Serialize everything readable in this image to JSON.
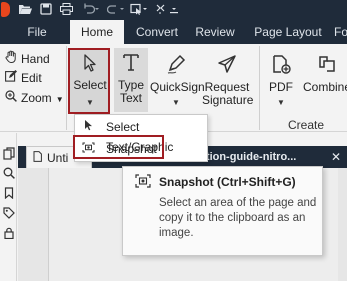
{
  "quick_access": {
    "icons": [
      "nitro-logo",
      "open-folder-icon",
      "save-icon",
      "print-icon",
      "undo-icon",
      "redo-icon",
      "dropdown-tool-icon",
      "customize-icon"
    ]
  },
  "tabs": [
    {
      "label": "File"
    },
    {
      "label": "Home"
    },
    {
      "label": "Convert"
    },
    {
      "label": "Review"
    },
    {
      "label": "Page Layout"
    },
    {
      "label": "Fo"
    }
  ],
  "ribbon": {
    "view_items": [
      {
        "label": "Hand",
        "icon": "hand-icon"
      },
      {
        "label": "Edit",
        "icon": "edit-icon"
      },
      {
        "label": "Zoom",
        "icon": "zoom-icon"
      }
    ],
    "tools": {
      "select": {
        "line1": "Select",
        "icon": "cursor-icon"
      },
      "type_text": {
        "line1": "Type",
        "line2": "Text",
        "icon": "text-icon"
      },
      "quicksign": {
        "line1": "QuickSign",
        "icon": "pen-icon"
      },
      "request_signature": {
        "line1": "Request",
        "line2": "Signature",
        "icon": "send-icon"
      }
    },
    "create": {
      "pdf": {
        "line1": "PDF",
        "icon": "pdf-add-icon"
      },
      "combine": {
        "line1": "Combine",
        "icon": "combine-icon"
      },
      "group_label": "Create"
    }
  },
  "select_menu": {
    "items": [
      {
        "label": "Select Text/Graphic",
        "icon": "cursor-icon"
      },
      {
        "label": "Snapshot",
        "icon": "snapshot-icon"
      }
    ]
  },
  "doc_tabs": {
    "tab1": "Unti",
    "tab2": "installation-guide-nitro...",
    "close": "✕"
  },
  "tooltip": {
    "title": "Snapshot (Ctrl+Shift+G)",
    "description": "Select an area of the page and copy it to the clipboard as an image."
  },
  "colors": {
    "title_bar": "#1f2b3a",
    "ribbon_bg": "#f3f3f3",
    "highlight_red": "#a01d22",
    "brand": "#e8461d"
  }
}
